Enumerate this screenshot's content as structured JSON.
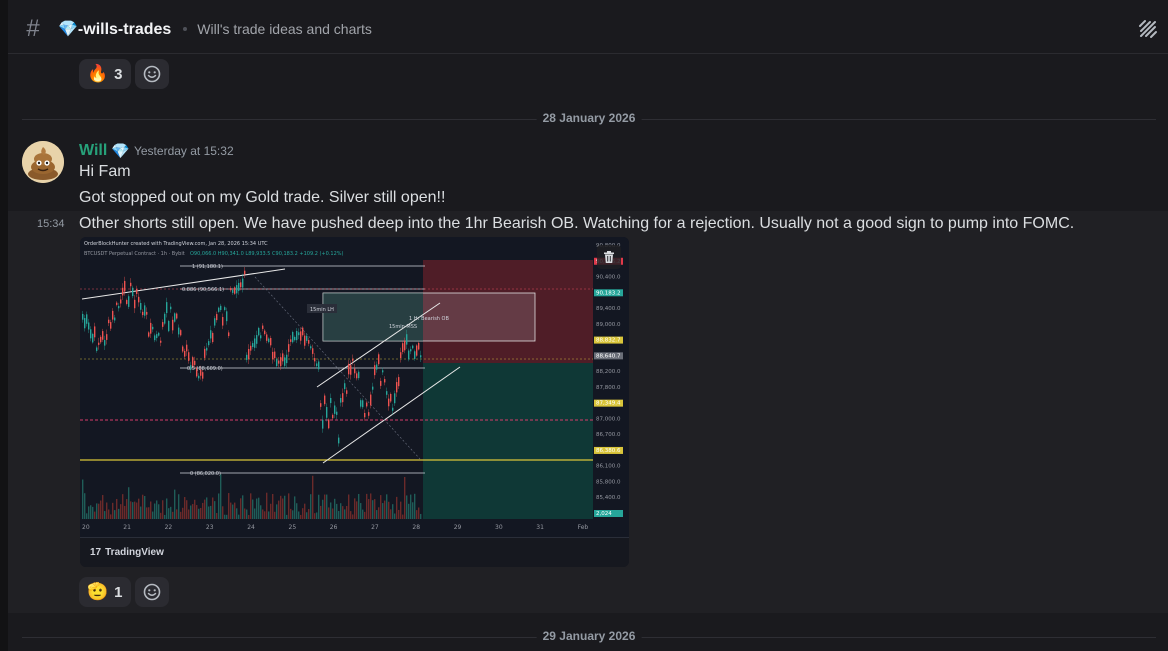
{
  "channel": {
    "emoji": "💎",
    "name": "💎-wills-trades",
    "topic": "Will's trade ideas and charts"
  },
  "reactions_top": [
    {
      "emoji": "🔥",
      "count": "3"
    }
  ],
  "dividers": {
    "first": "28 January 2026",
    "second": "29 January 2026"
  },
  "message": {
    "author": "Will",
    "author_badge": "💎",
    "timestamp": "Yesterday at 15:32",
    "lines": [
      "Hi Fam",
      "Got stopped out on my Gold trade. Silver still open!!"
    ],
    "followup_time": "15:34",
    "followup_text": "Other shorts still open. We have pushed deep into the 1hr Bearish OB. Watching for a rejection. Usually not a good sign to pump into FOMC."
  },
  "chart_embed": {
    "credit": "OrderBlockHunter created with TradingView.com, Jan 28, 2026 15:34 UTC",
    "symbol_line": "BTCUSDT Perpetual Contract · 1h · Bybit",
    "ohlc": "O90,066.0  H90,341.0  L89,933.5  C90,183.2  +109.2 (+0.12%)",
    "annotations": {
      "fib_1": "1 (91,180.1)",
      "fib_886": "0.886 (90,566.1)",
      "fib_05": "0.5 (88,609.0)",
      "fib_0": "0 (86,020.0)",
      "lh_label": "15min LH",
      "mss_label": "15min MSS",
      "ob_label": "1 Hr Bearish OB"
    },
    "price_labels": [
      "90,800.0",
      "90,566.2",
      "90,400.0",
      "90,183.2",
      "89,400.0",
      "89,000.0",
      "88,832.7",
      "88,640.7",
      "88,200.0",
      "87,800.0",
      "87,349.4",
      "87,000.0",
      "86,700.0",
      "86,380.6",
      "86,100.0",
      "85,800.0",
      "85,400.0",
      "2,024"
    ],
    "time_labels": [
      "20",
      "21",
      "22",
      "23",
      "24",
      "25",
      "26",
      "27",
      "28",
      "29",
      "30",
      "31",
      "Feb"
    ],
    "brand": "TradingView",
    "brand_logo": "17"
  },
  "reactions_bottom": [
    {
      "emoji": "🫡",
      "count": "1"
    }
  ]
}
